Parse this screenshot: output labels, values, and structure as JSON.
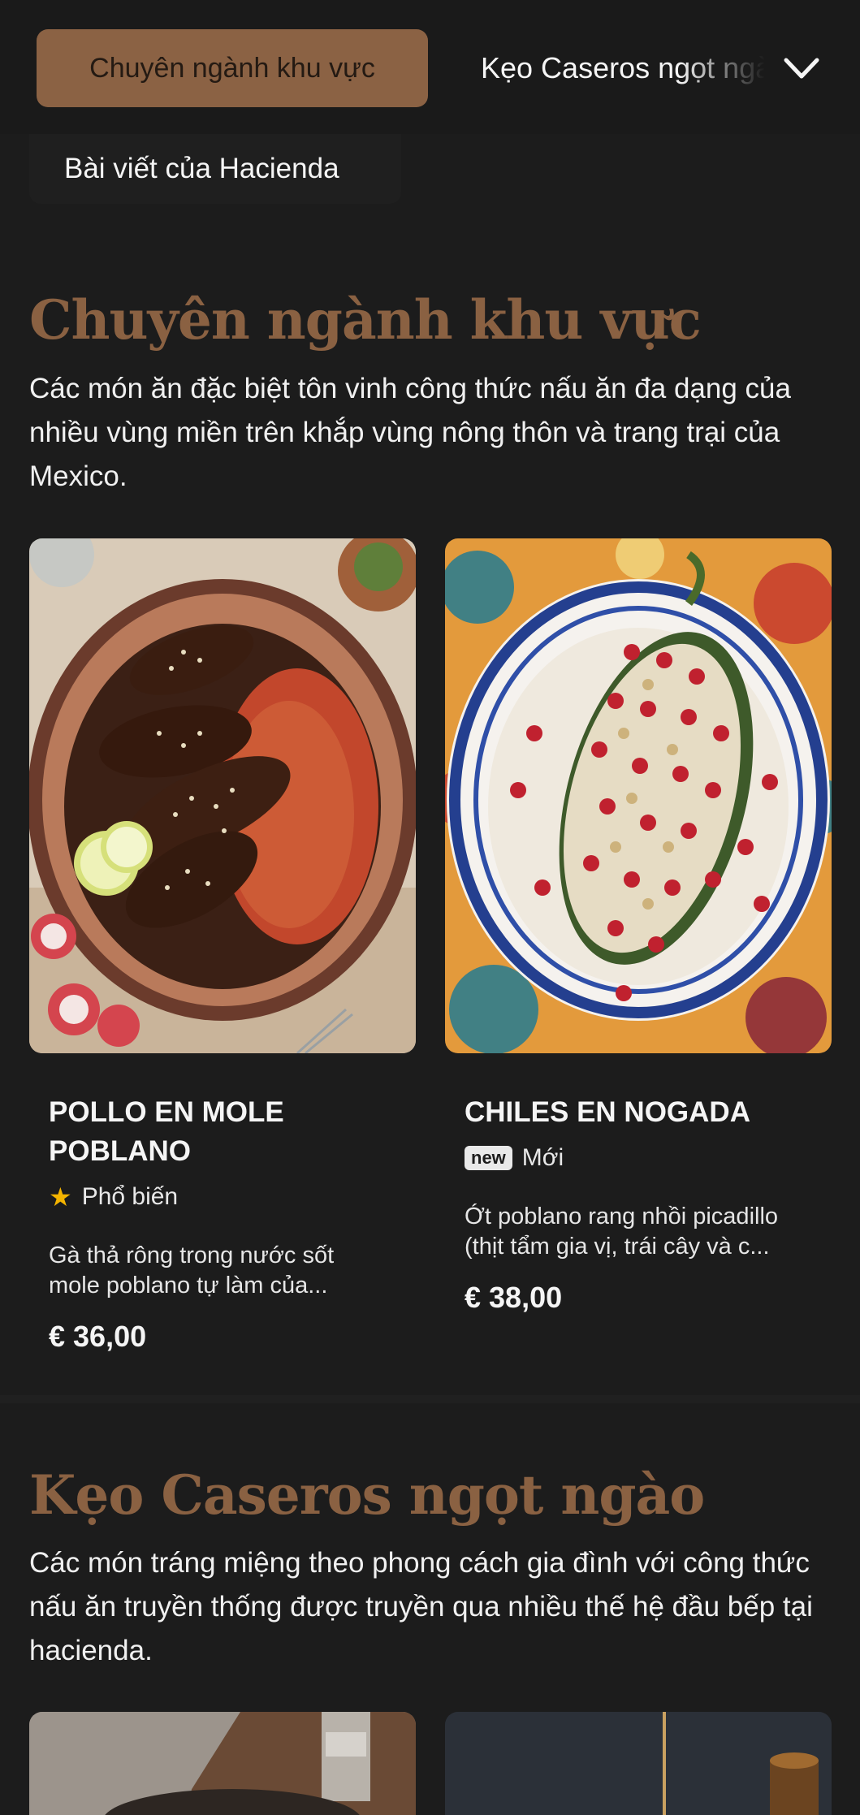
{
  "nav": {
    "active_tab": "Chuyên ngành khu vực",
    "next_tab": "Kẹo Caseros ngọt ngào",
    "hidden_tab": "Bài viết của Hacienda"
  },
  "sections": [
    {
      "title": "Chuyên ngành khu vực",
      "description": "Các món ăn đặc biệt tôn vinh công thức nấu ăn đa dạng của nhiều vùng miền trên khắp vùng nông thôn và trang trại của Mexico.",
      "items": [
        {
          "name": "POLLO EN MOLE POBLANO",
          "badge_label": "Phổ biến",
          "badge_icon": "star-icon",
          "description": "Gà thả rông trong nước sốt mole poblano tự làm của...",
          "price": "€ 36,00"
        },
        {
          "name": "CHILES EN NOGADA",
          "badge_tag": "new",
          "badge_label": "Mới",
          "description": "Ớt poblano rang nhồi picadillo (thịt tẩm gia vị, trái cây và c...",
          "price": "€ 38,00"
        }
      ]
    },
    {
      "title": "Kẹo Caseros ngọt ngào",
      "description": "Các món tráng miệng theo phong cách gia đình với công thức nấu ăn truyền thống được truyền qua nhiều thế hệ đầu bếp tại hacienda."
    }
  ],
  "colors": {
    "background": "#1c1c1c",
    "accent": "#8b6244",
    "heading": "#8a6142",
    "star": "#f4b400"
  }
}
